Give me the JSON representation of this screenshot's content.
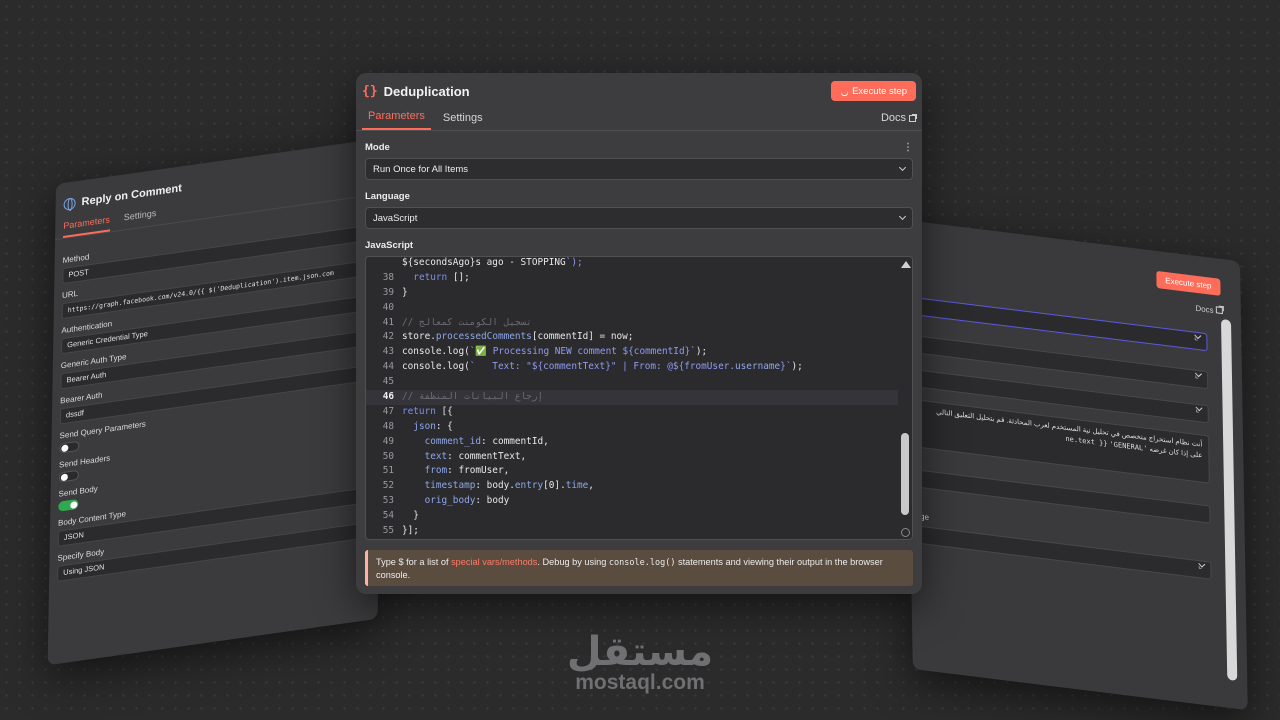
{
  "left_panel": {
    "title": "Reply on Comment",
    "tabs": [
      "Parameters",
      "Settings"
    ],
    "fields": [
      {
        "label": "Method",
        "value": "POST"
      },
      {
        "label": "URL",
        "value": "https://graph.facebook.com/v24.0/{{ $('Deduplication').item.json.com"
      },
      {
        "label": "Authentication",
        "value": "Generic Credential Type"
      },
      {
        "label": "Generic Auth Type",
        "value": "Bearer Auth"
      },
      {
        "label": "Bearer Auth",
        "value": "dssdf"
      }
    ],
    "toggles": [
      {
        "label": "Send Query Parameters",
        "on": false
      },
      {
        "label": "Send Headers",
        "on": false
      },
      {
        "label": "Send Body",
        "on": true
      }
    ],
    "fields2": [
      {
        "label": "Body Content Type",
        "value": "JSON"
      },
      {
        "label": "Specify Body",
        "value": "Using JSON"
      }
    ]
  },
  "right_panel": {
    "execute_label": "Execute step",
    "docs_label": "Docs",
    "arabic_text_1": "أنت نظام استخراج متخصص في تحليل نية المستخدم لعرب المحادثة. قم بتحليل التعليق التالي على",
    "arabic_text_2": "إذا كان غرضه",
    "code_fragment_1": "'GENERAL'",
    "code_fragment_2": "ne.text }}",
    "label_fragment": "ge"
  },
  "main": {
    "icon": "{}",
    "title": "Deduplication",
    "execute_label": "Execute step",
    "tabs": [
      "Parameters",
      "Settings"
    ],
    "docs_label": "Docs",
    "mode_label": "Mode",
    "mode_value": "Run Once for All Items",
    "language_label": "Language",
    "language_value": "JavaScript",
    "code_label": "JavaScript",
    "hint_prefix": "Type $ for a list of ",
    "hint_link": "special vars/methods",
    "hint_mid": ". Debug by using ",
    "hint_code": "console.log()",
    "hint_suffix": " statements and viewing their output in the browser console."
  },
  "code_lines": [
    {
      "n": "",
      "t": "${secondsAgo}s ago - STOPPING`);"
    },
    {
      "n": "38",
      "t": "  return [];"
    },
    {
      "n": "39",
      "t": "}"
    },
    {
      "n": "40",
      "t": ""
    },
    {
      "n": "41",
      "t": "// تسجيل الكومنت كمعالج"
    },
    {
      "n": "42",
      "t": "store.processedComments[commentId] = now;"
    },
    {
      "n": "43",
      "t": "console.log(`✅ Processing NEW comment ${commentId}`);"
    },
    {
      "n": "44",
      "t": "console.log(`   Text: \"${commentText}\" | From: @${fromUser.username}`);"
    },
    {
      "n": "45",
      "t": ""
    },
    {
      "n": "46",
      "t": "// إرجاع البيانات المنظفة"
    },
    {
      "n": "47",
      "t": "return [{"
    },
    {
      "n": "48",
      "t": "  json: {"
    },
    {
      "n": "49",
      "t": "    comment_id: commentId,"
    },
    {
      "n": "50",
      "t": "    text: commentText,"
    },
    {
      "n": "51",
      "t": "    from: fromUser,"
    },
    {
      "n": "52",
      "t": "    timestamp: body.entry[0].time,"
    },
    {
      "n": "53",
      "t": "    orig_body: body"
    },
    {
      "n": "54",
      "t": "  }"
    },
    {
      "n": "55",
      "t": "}];"
    }
  ],
  "watermark": {
    "arabic": "مستقل",
    "latin": "mostaql.com"
  },
  "colors": {
    "accent": "#ff6d5a",
    "panel": "#3d3d40",
    "editor": "#2b2b2e",
    "hint_bg": "#5a4c3f"
  }
}
